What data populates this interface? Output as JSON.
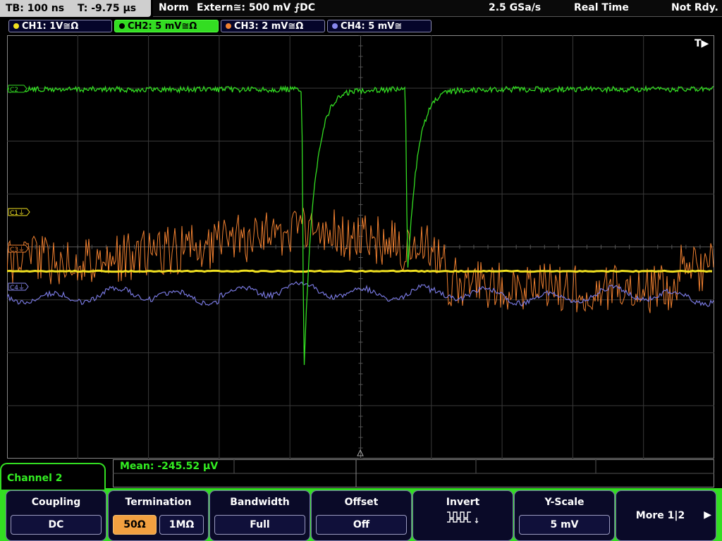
{
  "status": {
    "timebase": "TB: 100 ns",
    "trigger_time": "T: -9.75 µs",
    "mode": "Norm",
    "trigger_source": "Extern≅: 500 mV ⨍DC",
    "sample_rate": "2.5 GSa/s",
    "acq_mode": "Real Time",
    "ready_state": "Not Rdy."
  },
  "channels": [
    {
      "label": "CH1: 1V≅Ω",
      "color": "#f0e020",
      "active": false
    },
    {
      "label": "CH2: 5 mV≅Ω",
      "color": "#33dd22",
      "active": true
    },
    {
      "label": "CH3: 2 mV≅Ω",
      "color": "#f08030",
      "active": false
    },
    {
      "label": "CH4: 5 mV≅",
      "color": "#8888ee",
      "active": false
    }
  ],
  "trigger_marker": "T▶",
  "markers": {
    "c1": "C1⏚",
    "c3": "C3⏚",
    "c4": "C4⏚",
    "c2": "C2"
  },
  "measurement": {
    "mean": "Mean: -245.52 µV"
  },
  "menu": {
    "title": "Channel 2",
    "coupling": {
      "title": "Coupling",
      "value": "DC"
    },
    "termination": {
      "title": "Termination",
      "opt1": "50Ω",
      "opt2": "1MΩ",
      "selected": "50Ω"
    },
    "bandwidth": {
      "title": "Bandwidth",
      "value": "Full"
    },
    "offset": {
      "title": "Offset",
      "value": "Off"
    },
    "invert": {
      "title": "Invert"
    },
    "yscale": {
      "title": "Y-Scale",
      "value": "5 mV"
    },
    "more": {
      "label": "More 1|2",
      "arrow": "▶"
    }
  },
  "colors": {
    "ch1": "#f0e020",
    "ch2": "#33dd22",
    "ch3": "#f08030",
    "ch4": "#8888ee",
    "accent": "#33dd22"
  }
}
